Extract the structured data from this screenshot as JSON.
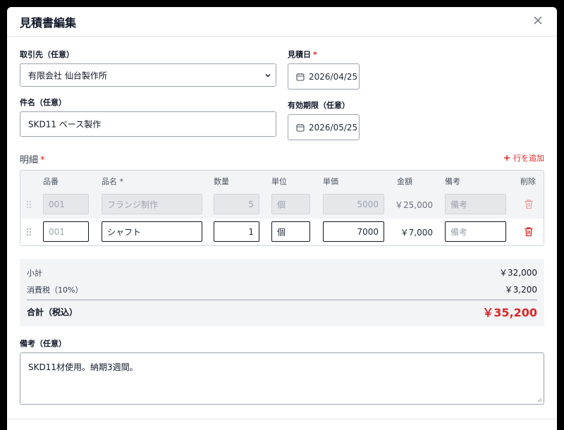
{
  "modal": {
    "title": "見積書編集",
    "close_label": "×"
  },
  "form": {
    "client": {
      "label": "取引先（任意）",
      "value": "有限会社 仙台製作所"
    },
    "quote_date": {
      "label": "見積日",
      "required_mark": "*",
      "value": "2026/04/25"
    },
    "subject": {
      "label": "件名（任意）",
      "value": "SKD11 ベース製作"
    },
    "expiry": {
      "label": "有効期限（任意）",
      "value": "2026/05/25"
    }
  },
  "items": {
    "title": "明細",
    "required_mark": "*",
    "add_row_label": "行を追加",
    "columns": [
      "品番",
      "品名 *",
      "数量",
      "単位",
      "単価",
      "金額",
      "備考",
      "削除"
    ],
    "rows": [
      {
        "part_no": "",
        "part_no_placeholder": "001",
        "name": "フランジ制作",
        "qty": "5",
        "unit": "個",
        "unit_price": "5000",
        "amount": "￥25,000",
        "note": "",
        "note_placeholder": "備考",
        "disabled": true
      },
      {
        "part_no": "",
        "part_no_placeholder": "001",
        "name": "シャフト",
        "qty": "1",
        "unit": "個",
        "unit_price": "7000",
        "amount": "￥7,000",
        "note": "",
        "note_placeholder": "備考",
        "disabled": false
      }
    ]
  },
  "summary": {
    "subtotal_label": "小計",
    "subtotal": "￥32,000",
    "tax_label": "消費税（10%）",
    "tax": "￥3,200",
    "total_label": "合計（税込）",
    "total": "￥35,200"
  },
  "notes": {
    "label": "備考（任意）",
    "value": "SKD11材使用。納期3週間。"
  },
  "colors": {
    "accent": "#dc2626",
    "border": "#9ca3af",
    "panel": "#f3f4f6"
  }
}
